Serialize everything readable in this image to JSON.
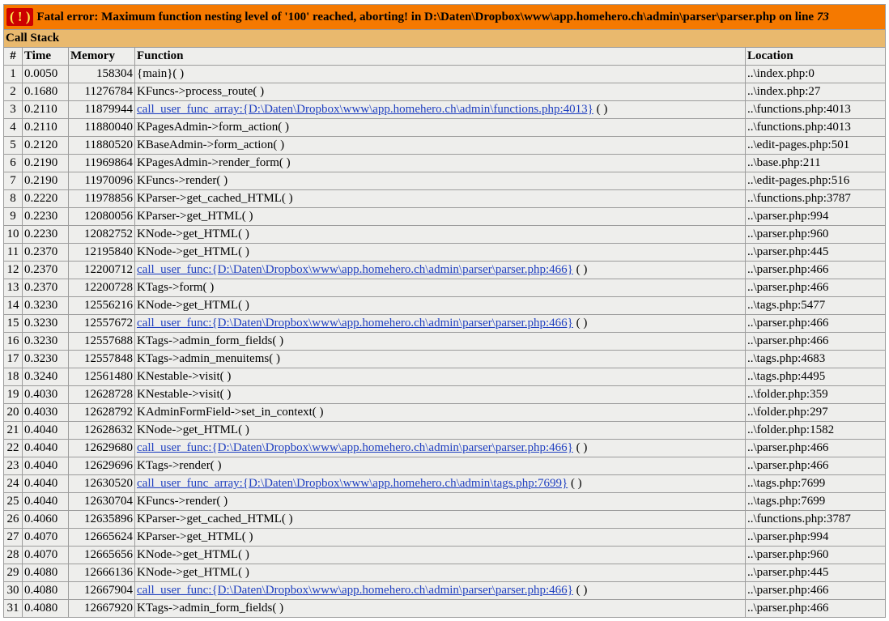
{
  "error": {
    "badge": "( ! )",
    "message": "Fatal error: Maximum function nesting level of '100' reached, aborting! in D:\\Daten\\Dropbox\\www\\app.homehero.ch\\admin\\parser\\parser.php on line ",
    "line": "73"
  },
  "call_stack": {
    "title": "Call Stack",
    "columns": [
      "#",
      "Time",
      "Memory",
      "Function",
      "Location"
    ],
    "rows": [
      {
        "n": "1",
        "time": "0.0050",
        "memory": "158304",
        "func": "{main}( )",
        "link": null,
        "location": "..\\index.php:0"
      },
      {
        "n": "2",
        "time": "0.1680",
        "memory": "11276784",
        "func": "KFuncs->process_route( )",
        "link": null,
        "location": "..\\index.php:27"
      },
      {
        "n": "3",
        "time": "0.2110",
        "memory": "11879944",
        "func": " ( )",
        "link": "call_user_func_array:{D:\\Daten\\Dropbox\\www\\app.homehero.ch\\admin\\functions.php:4013}",
        "location": "..\\functions.php:4013"
      },
      {
        "n": "4",
        "time": "0.2110",
        "memory": "11880040",
        "func": "KPagesAdmin->form_action( )",
        "link": null,
        "location": "..\\functions.php:4013"
      },
      {
        "n": "5",
        "time": "0.2120",
        "memory": "11880520",
        "func": "KBaseAdmin->form_action( )",
        "link": null,
        "location": "..\\edit-pages.php:501"
      },
      {
        "n": "6",
        "time": "0.2190",
        "memory": "11969864",
        "func": "KPagesAdmin->render_form( )",
        "link": null,
        "location": "..\\base.php:211"
      },
      {
        "n": "7",
        "time": "0.2190",
        "memory": "11970096",
        "func": "KFuncs->render( )",
        "link": null,
        "location": "..\\edit-pages.php:516"
      },
      {
        "n": "8",
        "time": "0.2220",
        "memory": "11978856",
        "func": "KParser->get_cached_HTML( )",
        "link": null,
        "location": "..\\functions.php:3787"
      },
      {
        "n": "9",
        "time": "0.2230",
        "memory": "12080056",
        "func": "KParser->get_HTML( )",
        "link": null,
        "location": "..\\parser.php:994"
      },
      {
        "n": "10",
        "time": "0.2230",
        "memory": "12082752",
        "func": "KNode->get_HTML( )",
        "link": null,
        "location": "..\\parser.php:960"
      },
      {
        "n": "11",
        "time": "0.2370",
        "memory": "12195840",
        "func": "KNode->get_HTML( )",
        "link": null,
        "location": "..\\parser.php:445"
      },
      {
        "n": "12",
        "time": "0.2370",
        "memory": "12200712",
        "func": " ( )",
        "link": "call_user_func:{D:\\Daten\\Dropbox\\www\\app.homehero.ch\\admin\\parser\\parser.php:466}",
        "location": "..\\parser.php:466"
      },
      {
        "n": "13",
        "time": "0.2370",
        "memory": "12200728",
        "func": "KTags->form( )",
        "link": null,
        "location": "..\\parser.php:466"
      },
      {
        "n": "14",
        "time": "0.3230",
        "memory": "12556216",
        "func": "KNode->get_HTML( )",
        "link": null,
        "location": "..\\tags.php:5477"
      },
      {
        "n": "15",
        "time": "0.3230",
        "memory": "12557672",
        "func": " ( )",
        "link": "call_user_func:{D:\\Daten\\Dropbox\\www\\app.homehero.ch\\admin\\parser\\parser.php:466}",
        "location": "..\\parser.php:466"
      },
      {
        "n": "16",
        "time": "0.3230",
        "memory": "12557688",
        "func": "KTags->admin_form_fields( )",
        "link": null,
        "location": "..\\parser.php:466"
      },
      {
        "n": "17",
        "time": "0.3230",
        "memory": "12557848",
        "func": "KTags->admin_menuitems( )",
        "link": null,
        "location": "..\\tags.php:4683"
      },
      {
        "n": "18",
        "time": "0.3240",
        "memory": "12561480",
        "func": "KNestable->visit( )",
        "link": null,
        "location": "..\\tags.php:4495"
      },
      {
        "n": "19",
        "time": "0.4030",
        "memory": "12628728",
        "func": "KNestable->visit( )",
        "link": null,
        "location": "..\\folder.php:359"
      },
      {
        "n": "20",
        "time": "0.4030",
        "memory": "12628792",
        "func": "KAdminFormField->set_in_context( )",
        "link": null,
        "location": "..\\folder.php:297"
      },
      {
        "n": "21",
        "time": "0.4040",
        "memory": "12628632",
        "func": "KNode->get_HTML( )",
        "link": null,
        "location": "..\\folder.php:1582"
      },
      {
        "n": "22",
        "time": "0.4040",
        "memory": "12629680",
        "func": " ( )",
        "link": "call_user_func:{D:\\Daten\\Dropbox\\www\\app.homehero.ch\\admin\\parser\\parser.php:466}",
        "location": "..\\parser.php:466"
      },
      {
        "n": "23",
        "time": "0.4040",
        "memory": "12629696",
        "func": "KTags->render( )",
        "link": null,
        "location": "..\\parser.php:466"
      },
      {
        "n": "24",
        "time": "0.4040",
        "memory": "12630520",
        "func": " ( )",
        "link": "call_user_func_array:{D:\\Daten\\Dropbox\\www\\app.homehero.ch\\admin\\tags.php:7699}",
        "location": "..\\tags.php:7699"
      },
      {
        "n": "25",
        "time": "0.4040",
        "memory": "12630704",
        "func": "KFuncs->render( )",
        "link": null,
        "location": "..\\tags.php:7699"
      },
      {
        "n": "26",
        "time": "0.4060",
        "memory": "12635896",
        "func": "KParser->get_cached_HTML( )",
        "link": null,
        "location": "..\\functions.php:3787"
      },
      {
        "n": "27",
        "time": "0.4070",
        "memory": "12665624",
        "func": "KParser->get_HTML( )",
        "link": null,
        "location": "..\\parser.php:994"
      },
      {
        "n": "28",
        "time": "0.4070",
        "memory": "12665656",
        "func": "KNode->get_HTML( )",
        "link": null,
        "location": "..\\parser.php:960"
      },
      {
        "n": "29",
        "time": "0.4080",
        "memory": "12666136",
        "func": "KNode->get_HTML( )",
        "link": null,
        "location": "..\\parser.php:445"
      },
      {
        "n": "30",
        "time": "0.4080",
        "memory": "12667904",
        "func": " ( )",
        "link": "call_user_func:{D:\\Daten\\Dropbox\\www\\app.homehero.ch\\admin\\parser\\parser.php:466}",
        "location": "..\\parser.php:466"
      },
      {
        "n": "31",
        "time": "0.4080",
        "memory": "12667920",
        "func": "KTags->admin_form_fields( )",
        "link": null,
        "location": "..\\parser.php:466"
      }
    ]
  },
  "colors": {
    "error_bar": "#f57900",
    "badge_bg": "#cc0000",
    "badge_fg": "#fce94f",
    "call_stack_bar": "#e9b96e",
    "row_bg": "#eeeeec",
    "link": "#2040c0"
  }
}
